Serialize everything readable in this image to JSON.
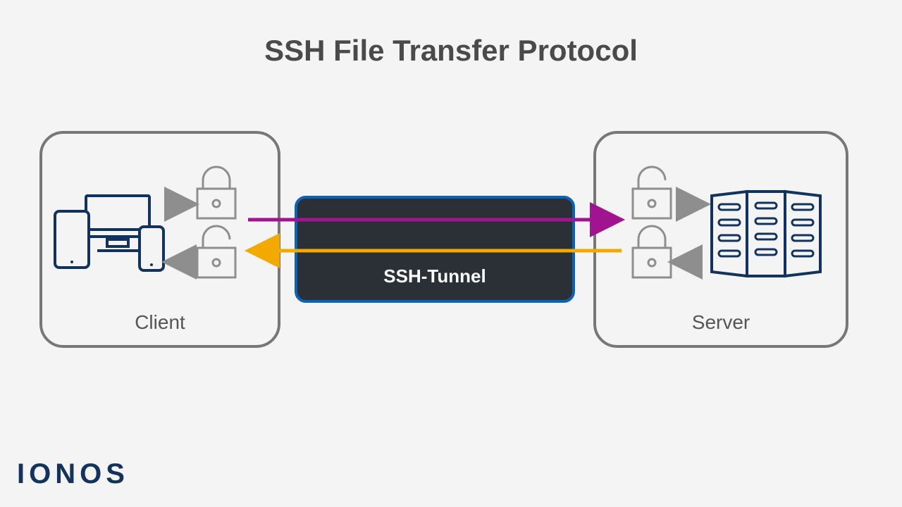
{
  "title": "SSH File Transfer Protocol",
  "client_label": "Client",
  "server_label": "Server",
  "tunnel_label": "SSH-Tunnel",
  "brand": "IONOS",
  "colors": {
    "request_arrow": "#a0158f",
    "response_arrow": "#f2a900",
    "icon_stroke": "#12335d",
    "lock_stroke": "#8e8e8e",
    "box_stroke": "#777777",
    "tunnel_bg": "#2b2f36",
    "tunnel_border": "#0a63b4"
  },
  "diagram": {
    "nodes": [
      "Client",
      "SSH-Tunnel",
      "Server"
    ],
    "flows": [
      {
        "from": "Client",
        "to": "Server",
        "via": "SSH-Tunnel",
        "direction": "request",
        "locked_in_transit": true
      },
      {
        "from": "Server",
        "to": "Client",
        "via": "SSH-Tunnel",
        "direction": "response",
        "locked_in_transit": true
      }
    ],
    "client_icons": [
      "tablet",
      "monitor",
      "phone"
    ],
    "server_icons": [
      "server-rack"
    ],
    "lock_states": {
      "client_outbound": "locked",
      "client_inbound": "unlocked",
      "server_inbound": "unlocked",
      "server_outbound": "locked"
    }
  }
}
